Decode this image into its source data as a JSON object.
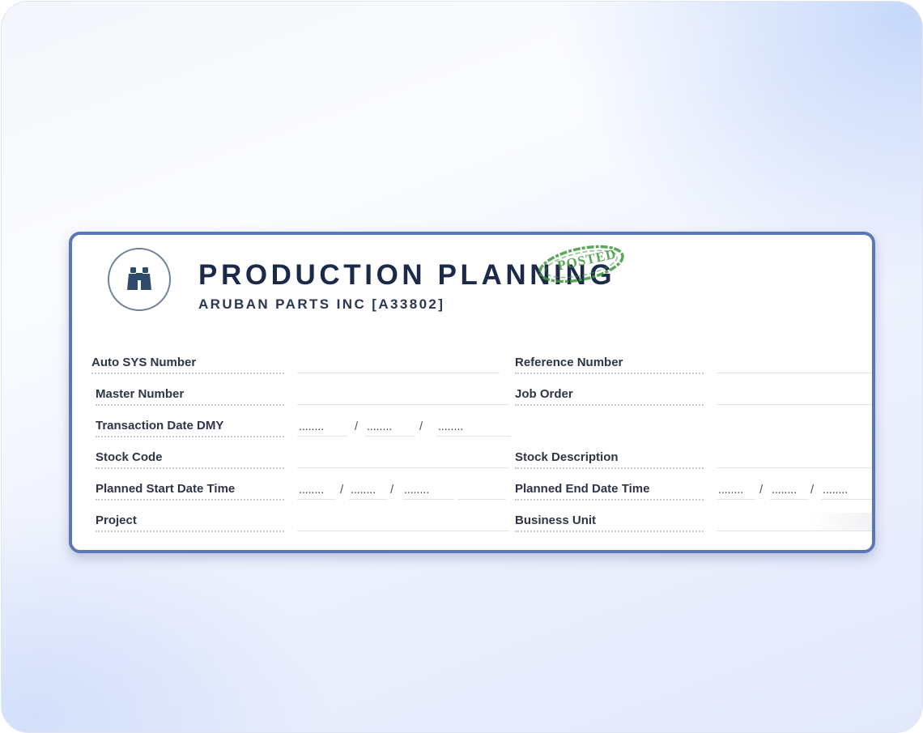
{
  "header": {
    "title": "PRODUCTION PLANNING",
    "company": "ARUBAN PARTS INC  [A33802]",
    "stamp": "POSTED",
    "logo_icon": "binoculars-icon"
  },
  "fields": {
    "auto_sys_number": {
      "label": "Auto SYS Number",
      "value": ""
    },
    "reference_number": {
      "label": "Reference Number",
      "value": ""
    },
    "master_number": {
      "label": "Master Number",
      "value": ""
    },
    "job_order": {
      "label": "Job Order",
      "value": ""
    },
    "transaction_date": {
      "label": "Transaction Date  DMY",
      "day": "........",
      "month": "........",
      "year": "........"
    },
    "stock_code": {
      "label": "Stock Code",
      "value": ""
    },
    "stock_description": {
      "label": "Stock Description",
      "value": ""
    },
    "planned_start": {
      "label": "Planned Start Date Time",
      "day": "........",
      "month": "........",
      "year": "........",
      "time": ""
    },
    "planned_end": {
      "label": "Planned End Date Time",
      "day": "........",
      "month": "........",
      "year": "........"
    },
    "project": {
      "label": "Project",
      "value": ""
    },
    "business_unit": {
      "label": "Business Unit",
      "value": ""
    }
  },
  "separator": "/",
  "colors": {
    "card_border": "#5b77b8",
    "title": "#1c2a4a",
    "stamp": "#3e963e"
  }
}
